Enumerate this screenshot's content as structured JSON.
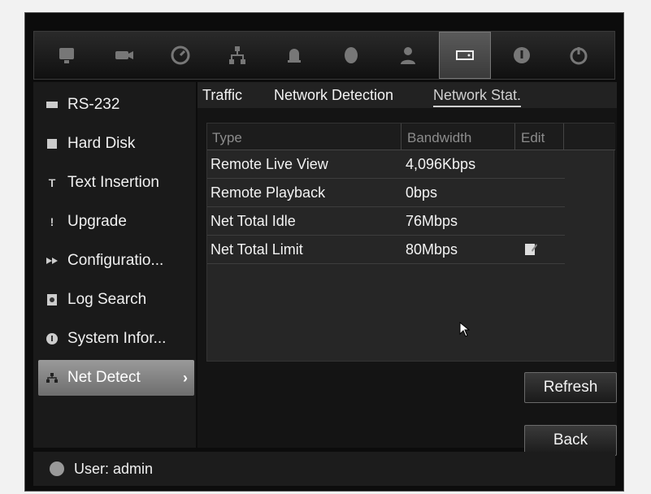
{
  "topbar": {
    "icons": [
      "monitor-icon",
      "camera-icon",
      "gauge-icon",
      "network-icon",
      "alarm-bell-icon",
      "dome-camera-icon",
      "user-icon",
      "device-management-icon",
      "info-icon",
      "power-icon"
    ]
  },
  "sidebar": {
    "items": [
      {
        "label": "RS-232",
        "icon": "serial-port-icon"
      },
      {
        "label": "Hard Disk",
        "icon": "hard-disk-icon"
      },
      {
        "label": "Text Insertion",
        "icon": "text-insertion-icon"
      },
      {
        "label": "Upgrade",
        "icon": "upgrade-icon"
      },
      {
        "label": "Configuratio...",
        "icon": "configuration-icon"
      },
      {
        "label": "Log Search",
        "icon": "log-search-icon"
      },
      {
        "label": "System Infor...",
        "icon": "system-info-icon"
      },
      {
        "label": "Net Detect",
        "icon": "net-detect-icon",
        "chevron": "›",
        "active": true
      }
    ]
  },
  "tabs": [
    "Traffic",
    "Network Detection",
    "Network Stat."
  ],
  "table": {
    "headers": [
      "Type",
      "Bandwidth",
      "Edit"
    ],
    "rows": [
      [
        "Remote Live View",
        "4,096Kbps"
      ],
      [
        "Remote Playback",
        "0bps"
      ],
      [
        "Net Total Idle",
        "76Mbps"
      ],
      [
        "Net Total Limit",
        "80Mbps"
      ]
    ]
  },
  "buttons": {
    "refresh": "Refresh",
    "back": "Back"
  },
  "footer": {
    "user": "User: admin"
  },
  "colors": {
    "active_item": "#8a8a8a",
    "background": "#0c0c0c"
  }
}
